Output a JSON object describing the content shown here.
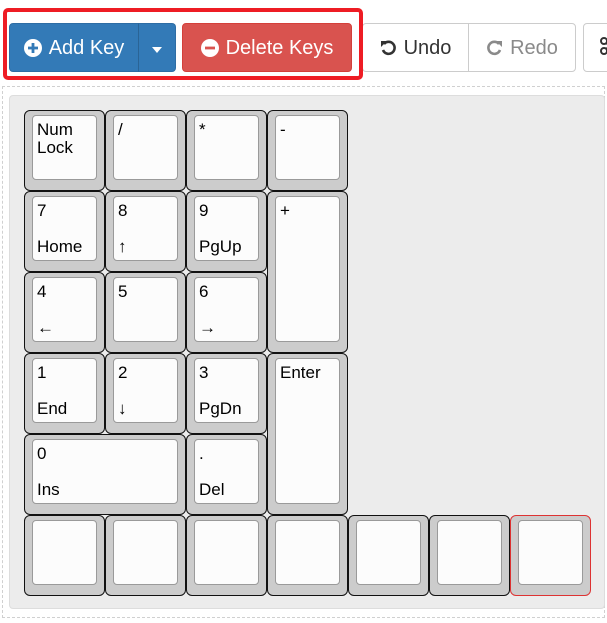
{
  "toolbar": {
    "add_key_label": "Add Key",
    "delete_keys_label": "Delete Keys",
    "undo_label": "Undo",
    "redo_label": "Redo"
  },
  "keys": [
    {
      "id": "numlock",
      "top": "Num\nLock",
      "bottom": ""
    },
    {
      "id": "slash",
      "top": "/",
      "bottom": ""
    },
    {
      "id": "asterisk",
      "top": "*",
      "bottom": ""
    },
    {
      "id": "minus",
      "top": "-",
      "bottom": ""
    },
    {
      "id": "seven",
      "top": "7",
      "bottom": "Home"
    },
    {
      "id": "eight",
      "top": "8",
      "bottom": "↑"
    },
    {
      "id": "nine",
      "top": "9",
      "bottom": "PgUp"
    },
    {
      "id": "plus",
      "top": "+",
      "bottom": ""
    },
    {
      "id": "four",
      "top": "4",
      "bottom": "←"
    },
    {
      "id": "five",
      "top": "5",
      "bottom": ""
    },
    {
      "id": "six",
      "top": "6",
      "bottom": "→"
    },
    {
      "id": "one",
      "top": "1",
      "bottom": "End"
    },
    {
      "id": "two",
      "top": "2",
      "bottom": "↓"
    },
    {
      "id": "three",
      "top": "3",
      "bottom": "PgDn"
    },
    {
      "id": "enter",
      "top": "Enter",
      "bottom": ""
    },
    {
      "id": "zero",
      "top": "0",
      "bottom": "Ins"
    },
    {
      "id": "period",
      "top": ".",
      "bottom": "Del"
    },
    {
      "id": "blank1",
      "top": "",
      "bottom": ""
    },
    {
      "id": "blank2",
      "top": "",
      "bottom": ""
    },
    {
      "id": "blank3",
      "top": "",
      "bottom": ""
    },
    {
      "id": "blank4",
      "top": "",
      "bottom": ""
    },
    {
      "id": "blank5",
      "top": "",
      "bottom": ""
    },
    {
      "id": "blank6",
      "top": "",
      "bottom": ""
    },
    {
      "id": "blank7",
      "top": "",
      "bottom": "",
      "selected": true
    }
  ],
  "colors": {
    "primary": "#337ab7",
    "danger": "#d9534f",
    "highlight": "#ee1c24",
    "selected_key_border": "#dd3333"
  },
  "icons": {
    "add": "plus-circle-icon",
    "dropdown": "caret-down-icon",
    "delete": "minus-circle-icon",
    "undo": "undo-icon",
    "redo": "redo-icon",
    "more": "scissors-icon"
  }
}
